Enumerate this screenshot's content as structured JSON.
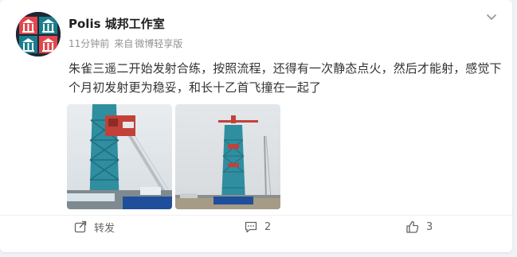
{
  "post": {
    "username": "Polis 城邦工作室",
    "time": "11分钟前",
    "source_prefix": "来自",
    "source": "微博轻享版",
    "text": "朱雀三遥二开始发射合练，按照流程，还得有一次静态点火，然后才能射，感觉下个月初发射更为稳妥，和长十乙首飞撞在一起了"
  },
  "images": [
    {
      "name": "rocket-tower-photo-1"
    },
    {
      "name": "rocket-tower-photo-2"
    }
  ],
  "actions": {
    "repost_label": "转发",
    "comment_count": "2",
    "like_count": "3"
  },
  "icons": {
    "more": "chevron-down-icon",
    "repost": "share-icon",
    "comment": "comment-icon",
    "like": "thumbs-up-icon"
  },
  "colors": {
    "avatar_red": "#e0464b",
    "avatar_teal": "#1a7d8c",
    "avatar_dark": "#1d2733",
    "meta_gray": "#939393"
  }
}
